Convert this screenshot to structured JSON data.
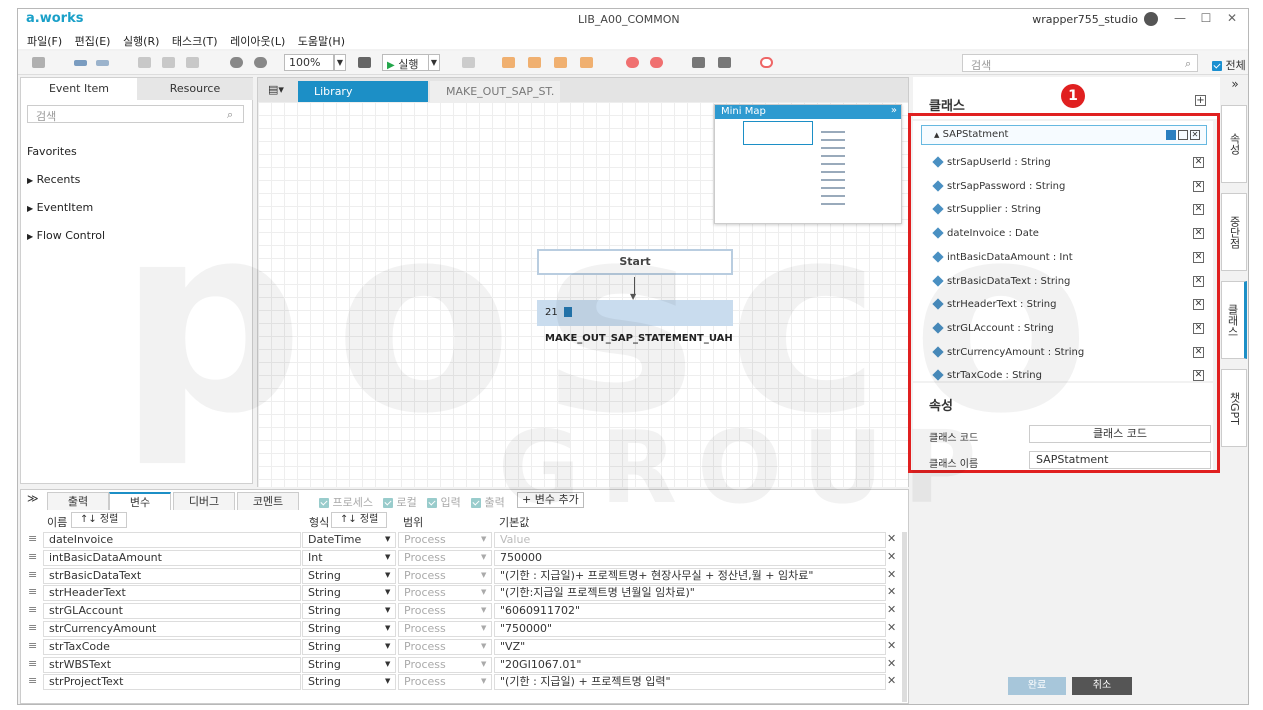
{
  "app": {
    "brand": "a.works",
    "window_title": "LIB_A00_COMMON",
    "user": "wrapper755_studio",
    "minimize": "—",
    "maximize": "☐",
    "close": "✕"
  },
  "menu": [
    "파일(F)",
    "편집(E)",
    "실행(R)",
    "태스크(T)",
    "레이아웃(L)",
    "도움말(H)"
  ],
  "toolbar": {
    "zoom": "100%",
    "run_label": "실행",
    "search_placeholder": "검색",
    "all_label": "전체"
  },
  "left_panel": {
    "tabs": [
      "Event Item",
      "Resource"
    ],
    "search_placeholder": "검색",
    "favorites": "Favorites",
    "items": [
      "Recents",
      "EventItem",
      "Flow Control"
    ]
  },
  "canvas": {
    "tabs": [
      "Library",
      "MAKE_OUT_SAP_ST."
    ],
    "minimap_title": "Mini Map",
    "start_node": "Start",
    "flow_node_index": "21",
    "flow_node_label": "MAKE_OUT_SAP_STATEMENT_UAH"
  },
  "bottom_panel": {
    "tabs": [
      "출력",
      "변수",
      "디버그",
      "코멘트"
    ],
    "filters": [
      "프로세스",
      "로컬",
      "입력",
      "출력"
    ],
    "add_var": "+ 변수 추가",
    "headers": {
      "name": "이름",
      "sort": "↑↓ 정렬",
      "type": "형식",
      "scope": "범위",
      "default": "기본값"
    },
    "rows": [
      {
        "name": "dateInvoice",
        "type": "DateTime",
        "scope": "Process",
        "value": "Value"
      },
      {
        "name": "intBasicDataAmount",
        "type": "Int",
        "scope": "Process",
        "value": "750000"
      },
      {
        "name": "strBasicDataText",
        "type": "String",
        "scope": "Process",
        "value": "\"(기한 : 지급일)+ 프로젝트명+ 현장사무실 + 정산년,월 + 임차료\""
      },
      {
        "name": "strHeaderText",
        "type": "String",
        "scope": "Process",
        "value": "\"(기한:지급일 프로젝트명 년월일 임차료)\""
      },
      {
        "name": "strGLAccount",
        "type": "String",
        "scope": "Process",
        "value": "\"6060911702\""
      },
      {
        "name": "strCurrencyAmount",
        "type": "String",
        "scope": "Process",
        "value": "\"750000\""
      },
      {
        "name": "strTaxCode",
        "type": "String",
        "scope": "Process",
        "value": "\"VZ\""
      },
      {
        "name": "strWBSText",
        "type": "String",
        "scope": "Process",
        "value": "\"20GI1067.01\""
      },
      {
        "name": "strProjectText",
        "type": "String",
        "scope": "Process",
        "value": "\"(기한 : 지급일) + 프로젝트명 입력\""
      }
    ]
  },
  "class_panel": {
    "title": "클래스",
    "badge": "1",
    "class_name": "SAPStatment",
    "members": [
      "strSapUserId : String",
      "strSapPassword : String",
      "strSupplier : String",
      "dateInvoice : Date",
      "intBasicDataAmount : Int",
      "strBasicDataText : String",
      "strHeaderText : String",
      "strGLAccount : String",
      "strCurrencyAmount : String",
      "strTaxCode : String"
    ],
    "props_title": "속성",
    "class_code_label": "클래스 코드",
    "class_code_value": "클래스 코드",
    "class_name_label": "클래스 이름",
    "class_name_value": "SAPStatment",
    "ok": "완료",
    "cancel": "취소"
  },
  "side_tabs": [
    "속성",
    "중단점",
    "클래스",
    "챗GPT"
  ],
  "watermark": {
    "top": "posco",
    "bottom": "GROUP"
  }
}
